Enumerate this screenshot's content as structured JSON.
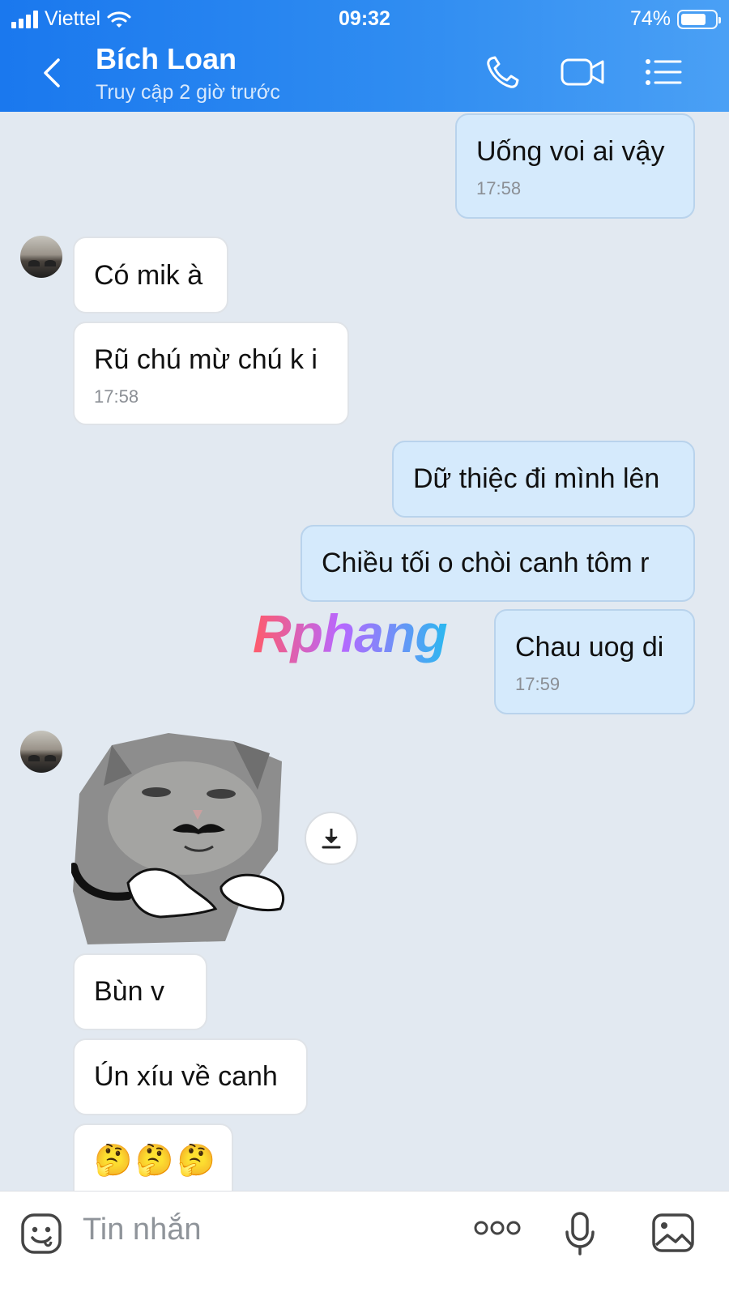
{
  "status_bar": {
    "carrier": "Viettel",
    "time": "09:32",
    "battery": "74%"
  },
  "header": {
    "name": "Bích Loan",
    "subtitle": "Truy cập 2 giờ trước"
  },
  "messages": [
    {
      "dir": "out",
      "text": "Uống voi ai vậy",
      "time": "17:58"
    },
    {
      "dir": "in",
      "text": "Có mik à"
    },
    {
      "dir": "in",
      "text": "Rũ chú mừ chú k i",
      "time": "17:58"
    },
    {
      "dir": "out",
      "text": "Dữ thiệc đi mình lên"
    },
    {
      "dir": "out",
      "text": "Chiều tối o chòi canh tôm r"
    },
    {
      "dir": "out",
      "text": "Chau uog di",
      "time": "17:59"
    },
    {
      "dir": "in",
      "text": "Bùn v"
    },
    {
      "dir": "in",
      "text": "Ún xíu về canh"
    },
    {
      "dir": "in",
      "text": "🤔🤔🤔"
    }
  ],
  "watermark": "Rphang",
  "input": {
    "placeholder": "Tin nhắn"
  },
  "icons": {
    "back": "chevron-left-icon",
    "call": "phone-icon",
    "video": "video-camera-icon",
    "menu": "menu-list-icon",
    "sticker": "sticker-face-icon",
    "more": "more-dots-icon",
    "mic": "microphone-icon",
    "gallery": "image-icon",
    "download": "download-icon"
  },
  "colors": {
    "header": "#1a78ee",
    "outgoing": "#d5eafc",
    "incoming": "#ffffff",
    "background": "#e2e9f1"
  }
}
